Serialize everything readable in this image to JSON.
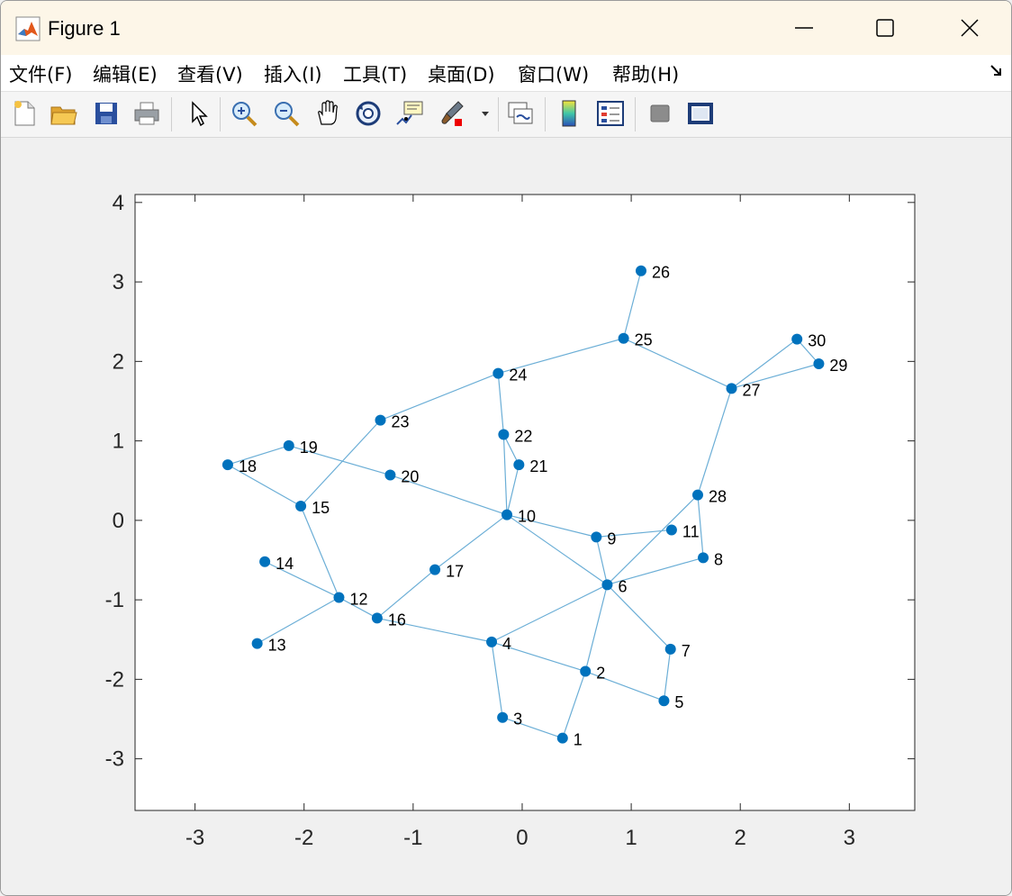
{
  "window": {
    "title": "Figure 1"
  },
  "menu": [
    {
      "label": "文件(F)"
    },
    {
      "label": "编辑(E)"
    },
    {
      "label": "查看(V)"
    },
    {
      "label": "插入(I)"
    },
    {
      "label": "工具(T)"
    },
    {
      "label": "桌面(D)"
    },
    {
      "label": "窗口(W)"
    },
    {
      "label": "帮助(H)"
    }
  ],
  "toolbar": [
    "new-figure-icon",
    "open-file-icon",
    "save-icon",
    "print-icon",
    "select-arrow-icon",
    "zoom-in-icon",
    "zoom-out-icon",
    "pan-hand-icon",
    "rotate-3d-icon",
    "data-tips-icon",
    "brush-icon",
    "brush-dropdown-icon",
    "link-plot-icon",
    "colorbar-icon",
    "legend-icon",
    "hide-plot-tools-icon",
    "show-plot-tools-icon"
  ],
  "colors": {
    "node": "#0072BD",
    "edge": "#6baed6",
    "titlebar": "#fdf6e3"
  },
  "chart_data": {
    "type": "graph",
    "xlim": [
      -3.55,
      3.6
    ],
    "ylim": [
      -3.65,
      4.1
    ],
    "x_ticks": [
      -3,
      -2,
      -1,
      0,
      1,
      2,
      3
    ],
    "y_ticks": [
      -3,
      -2,
      -1,
      0,
      1,
      2,
      3,
      4
    ],
    "nodes": [
      {
        "id": "1",
        "x": 0.37,
        "y": -2.74
      },
      {
        "id": "2",
        "x": 0.58,
        "y": -1.9
      },
      {
        "id": "3",
        "x": -0.18,
        "y": -2.48
      },
      {
        "id": "4",
        "x": -0.28,
        "y": -1.53
      },
      {
        "id": "5",
        "x": 1.3,
        "y": -2.27
      },
      {
        "id": "6",
        "x": 0.78,
        "y": -0.81
      },
      {
        "id": "7",
        "x": 1.36,
        "y": -1.62
      },
      {
        "id": "8",
        "x": 1.66,
        "y": -0.47
      },
      {
        "id": "9",
        "x": 0.68,
        "y": -0.21
      },
      {
        "id": "10",
        "x": -0.14,
        "y": 0.07
      },
      {
        "id": "11",
        "x": 1.37,
        "y": -0.12
      },
      {
        "id": "12",
        "x": -1.68,
        "y": -0.97
      },
      {
        "id": "13",
        "x": -2.43,
        "y": -1.55
      },
      {
        "id": "14",
        "x": -2.36,
        "y": -0.52
      },
      {
        "id": "15",
        "x": -2.03,
        "y": 0.18
      },
      {
        "id": "16",
        "x": -1.33,
        "y": -1.23
      },
      {
        "id": "17",
        "x": -0.8,
        "y": -0.62
      },
      {
        "id": "18",
        "x": -2.7,
        "y": 0.7
      },
      {
        "id": "19",
        "x": -2.14,
        "y": 0.94
      },
      {
        "id": "20",
        "x": -1.21,
        "y": 0.57
      },
      {
        "id": "21",
        "x": -0.03,
        "y": 0.7
      },
      {
        "id": "22",
        "x": -0.17,
        "y": 1.08
      },
      {
        "id": "23",
        "x": -1.3,
        "y": 1.26
      },
      {
        "id": "24",
        "x": -0.22,
        "y": 1.85
      },
      {
        "id": "25",
        "x": 0.93,
        "y": 2.29
      },
      {
        "id": "26",
        "x": 1.09,
        "y": 3.14
      },
      {
        "id": "27",
        "x": 1.92,
        "y": 1.66
      },
      {
        "id": "28",
        "x": 1.61,
        "y": 0.32
      },
      {
        "id": "29",
        "x": 2.72,
        "y": 1.97
      },
      {
        "id": "30",
        "x": 2.52,
        "y": 2.28
      }
    ],
    "edges": [
      [
        "1",
        "3"
      ],
      [
        "1",
        "2"
      ],
      [
        "2",
        "4"
      ],
      [
        "2",
        "5"
      ],
      [
        "2",
        "6"
      ],
      [
        "3",
        "4"
      ],
      [
        "4",
        "6"
      ],
      [
        "4",
        "16"
      ],
      [
        "5",
        "7"
      ],
      [
        "6",
        "7"
      ],
      [
        "6",
        "8"
      ],
      [
        "6",
        "9"
      ],
      [
        "6",
        "10"
      ],
      [
        "6",
        "28"
      ],
      [
        "8",
        "28"
      ],
      [
        "9",
        "10"
      ],
      [
        "9",
        "11"
      ],
      [
        "10",
        "17"
      ],
      [
        "10",
        "20"
      ],
      [
        "10",
        "21"
      ],
      [
        "10",
        "22"
      ],
      [
        "12",
        "13"
      ],
      [
        "12",
        "14"
      ],
      [
        "12",
        "15"
      ],
      [
        "12",
        "16"
      ],
      [
        "15",
        "18"
      ],
      [
        "15",
        "23"
      ],
      [
        "16",
        "17"
      ],
      [
        "18",
        "19"
      ],
      [
        "19",
        "20"
      ],
      [
        "21",
        "22"
      ],
      [
        "22",
        "24"
      ],
      [
        "23",
        "24"
      ],
      [
        "24",
        "25"
      ],
      [
        "25",
        "26"
      ],
      [
        "25",
        "27"
      ],
      [
        "27",
        "28"
      ],
      [
        "27",
        "29"
      ],
      [
        "27",
        "30"
      ],
      [
        "29",
        "30"
      ]
    ]
  }
}
